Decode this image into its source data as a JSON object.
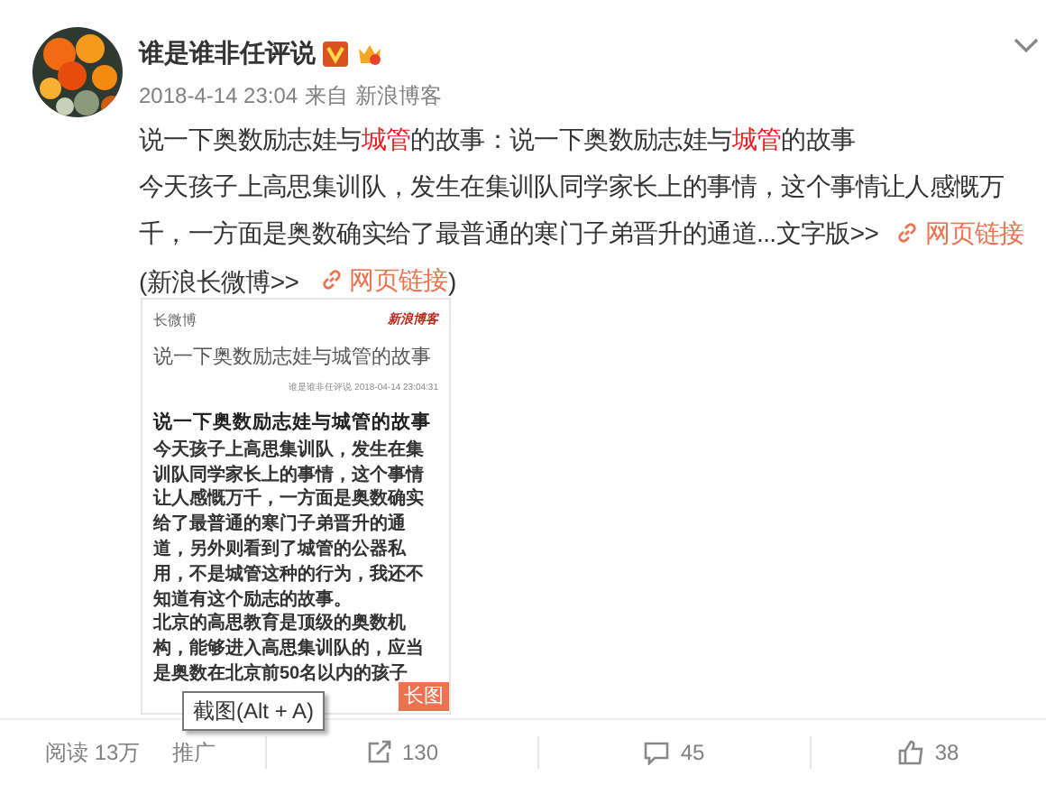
{
  "post": {
    "author": "谁是谁非任评说",
    "time": "2018-4-14 23:04",
    "source_prefix": "来自",
    "source": "新浪博客",
    "title_parts": [
      {
        "text": "说一下奥数励志娃与",
        "highlight": false
      },
      {
        "text": "城管",
        "highlight": true
      },
      {
        "text": "的故事：说一下奥数励志娃与",
        "highlight": false
      },
      {
        "text": "城管",
        "highlight": true
      },
      {
        "text": "的故事",
        "highlight": false
      }
    ],
    "body_lines": [
      "今天孩子上高思集训队，发生在集训队同学家长上的事情，这个事情让人感慨万",
      "千，一方面是奥数确实给了最普通的寒门子弟晋升的通道...文字版>>"
    ],
    "link_1": "网页链接",
    "long_weibo": "(新浪长微博>>",
    "link_2": "网页链接",
    "close_paren": ")"
  },
  "long_image": {
    "header": "长微博",
    "brand": "新浪博客",
    "title": "说一下奥数励志娃与城管的故事",
    "byline": "谁是谁非任评说  2018-04-14 23:04:31",
    "heading": "说一下奥数励志娃与城管的故事",
    "lines": [
      "今天孩子上高思集训队，发生在集",
      "训队同学家长上的事情，这个事情",
      "让人感慨万千，一方面是奥数确实",
      "给了最普通的寒门子弟晋升的通",
      "道，另外则看到了城管的公器私",
      "用，不是城管这种的行为，我还不",
      "知道有这个励志的故事。",
      "北京的高思教育是顶级的奥数机",
      "构，能够进入高思集训队的，应当",
      "是奥数在北京前50名以内的孩子"
    ],
    "badge": "长图"
  },
  "tooltip": "截图(Alt + A)",
  "footer": {
    "reads": "阅读 13万",
    "promote": "推广",
    "reposts": "130",
    "comments": "45",
    "likes": "38"
  }
}
